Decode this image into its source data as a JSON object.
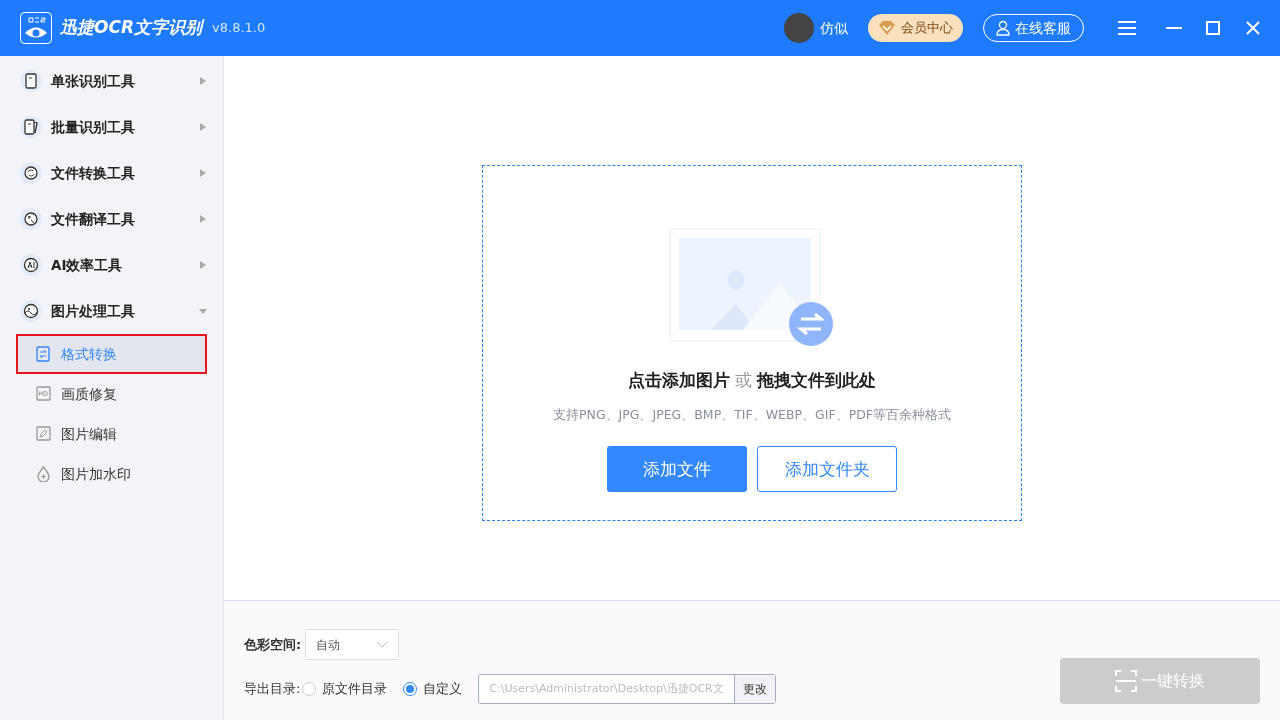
{
  "window": {
    "app_name": "迅捷OCR文字识别",
    "version": "v8.8.1.0"
  },
  "header": {
    "user_name": "仿似",
    "vip_button": "会员中心",
    "support_button": "在线客服"
  },
  "sidebar": {
    "items": [
      {
        "label": "单张识别工具",
        "expanded": false
      },
      {
        "label": "批量识别工具",
        "expanded": false
      },
      {
        "label": "文件转换工具",
        "expanded": false
      },
      {
        "label": "文件翻译工具",
        "expanded": false
      },
      {
        "label": "AI效率工具",
        "expanded": false
      },
      {
        "label": "图片处理工具",
        "expanded": true,
        "children": [
          {
            "label": "格式转换",
            "selected": true
          },
          {
            "label": "画质修复",
            "selected": false
          },
          {
            "label": "图片编辑",
            "selected": false
          },
          {
            "label": "图片加水印",
            "selected": false
          }
        ]
      }
    ]
  },
  "drop_zone": {
    "title": "**点击添加图片** 或 **拖拽文件到此处**",
    "hint": "支持PNG、JPG、JPEG、BMP、TIF、WEBP、GIF、PDF等百余种格式",
    "add_file_button": "添加文件",
    "add_folder_button": "添加文件夹"
  },
  "settings": {
    "color_space_label": "色彩空间:",
    "color_space_value": "自动",
    "output_label": "导出目录:",
    "output_options": [
      {
        "label": "原文件目录",
        "selected": false
      },
      {
        "label": "自定义",
        "selected": true
      }
    ],
    "output_path": "C:\\Users\\Administrator\\Desktop\\迅捷OCR文",
    "change_button": "更改",
    "convert_button": {
      "label": "一键转换",
      "disabled": true
    }
  }
}
